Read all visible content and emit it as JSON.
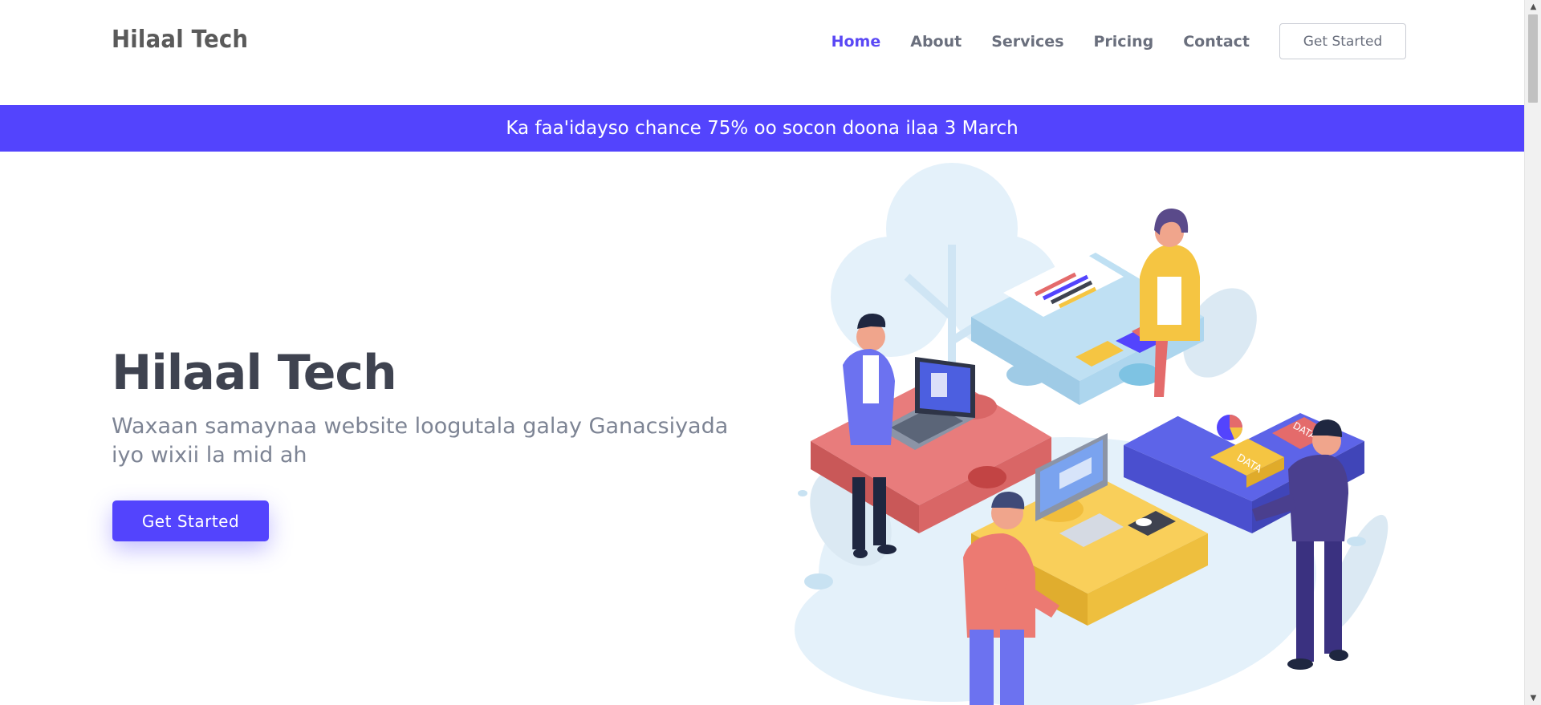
{
  "header": {
    "logo": "Hilaal Tech",
    "nav": [
      "Home",
      "About",
      "Services",
      "Pricing",
      "Contact"
    ],
    "active_nav": "Home",
    "cta_label": "Get Started"
  },
  "banner": {
    "text": "Ka faa'idayso chance 75% oo socon doona ilaa 3 March"
  },
  "hero": {
    "title": "Hilaal Tech",
    "subtitle": "Waxaan samaynaa website loogutala galay Ganacsiyada iyo wixii la mid ah",
    "button_label": "Get Started"
  },
  "illustration": {
    "tag_1": "DATA",
    "tag_2": "DATA"
  },
  "colors": {
    "accent": "#5344fd",
    "nav_active": "#5a48f5",
    "title": "#3f4350",
    "subtitle": "#7d8494"
  }
}
